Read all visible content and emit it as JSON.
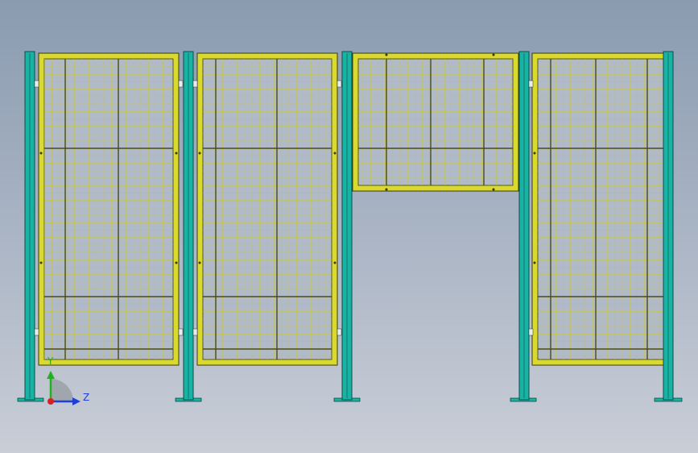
{
  "viewport": {
    "background_top": "#8a9bb0",
    "background_bottom": "#c9ced7"
  },
  "colors": {
    "post_fill": "#18b3a3",
    "post_stroke": "#0a4d48",
    "frame_fill": "#d9d92e",
    "frame_stroke": "#3a3a10",
    "mesh_line": "#c8c820",
    "mesh_rib": "#4a4a18",
    "axis_y": "#1fb31f",
    "axis_z": "#1f3fd9",
    "axis_origin": "#d92020"
  },
  "triad": {
    "y_label": "Y",
    "z_label": "Z",
    "y_icon": "y-axis-arrow-icon",
    "z_icon": "z-axis-arrow-icon",
    "origin_icon": "origin-dot-icon"
  }
}
